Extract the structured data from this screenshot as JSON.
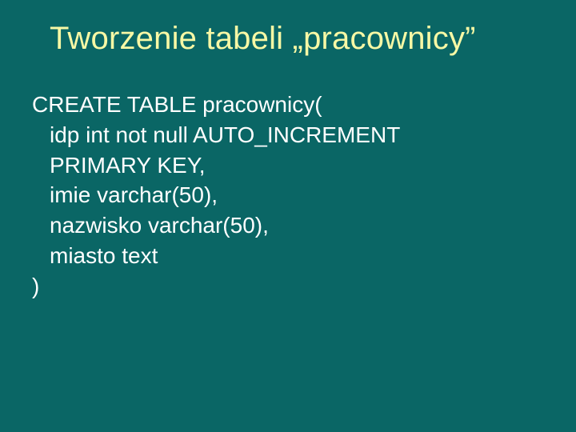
{
  "title": "Tworzenie tabeli „pracownicy”",
  "code": {
    "line1": "CREATE TABLE pracownicy(",
    "line2": "idp int not null AUTO_INCREMENT",
    "line3": "PRIMARY KEY,",
    "line4": "imie varchar(50),",
    "line5": "nazwisko varchar(50),",
    "line6": "miasto text",
    "line7": ")"
  }
}
